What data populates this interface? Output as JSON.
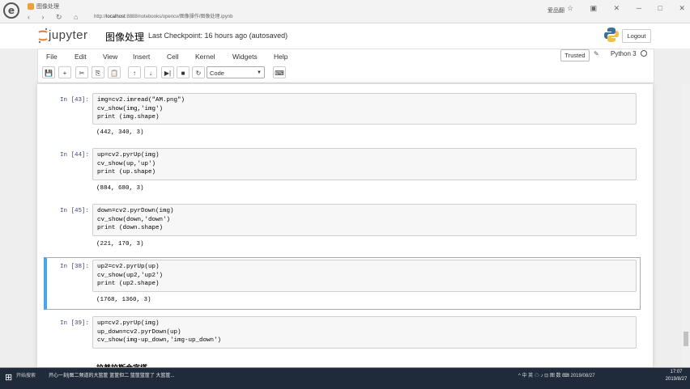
{
  "browser": {
    "logo": "e",
    "tab_title": "图像处理",
    "url_prefix": "http://",
    "url_host": "localhost",
    "url_rest": ":8888/notebooks/opencv/图像操作/图像处理.ipynb",
    "window_title": "爱品翻",
    "nav_icons": "‹ › ↻ ⌂",
    "window_controls": "☆ ▣ ✕ ─ □ ✕"
  },
  "jupyter": {
    "logo_text": "jupyter",
    "notebook_name": "图像处理",
    "checkpoint": "Last Checkpoint: 16 hours ago (autosaved)",
    "logout_label": "Logout",
    "trusted_label": "Trusted",
    "kernel_name": "Python 3"
  },
  "menu": [
    "File",
    "Edit",
    "View",
    "Insert",
    "Cell",
    "Kernel",
    "Widgets",
    "Help"
  ],
  "toolbar": {
    "save": "💾",
    "add": "+",
    "cut": "✂",
    "copy": "⎘",
    "paste": "📋",
    "up": "↑",
    "down": "↓",
    "run": "▶|",
    "stop": "■",
    "restart": "↻",
    "cell_type": "Code",
    "keyboard": "⌨"
  },
  "cells": [
    {
      "prompt": "In [43]:",
      "lines": [
        "img=cv2.imread(\"AM.png\")",
        "cv_show(img,'img')",
        "print (img.shape)"
      ],
      "output": "(442, 340, 3)"
    },
    {
      "prompt": "In [44]:",
      "lines": [
        "up=cv2.pyrUp(img)",
        "cv_show(up,'up')",
        "print (up.shape)"
      ],
      "output": "(884, 680, 3)"
    },
    {
      "prompt": "In [45]:",
      "lines": [
        "down=cv2.pyrDown(img)",
        "cv_show(down,'down')",
        "print (down.shape)"
      ],
      "output": "(221, 170, 3)"
    },
    {
      "prompt": "In [38]:",
      "lines": [
        "up2=cv2.pyrUp(up)",
        "cv_show(up2,'up2')",
        "print (up2.shape)"
      ],
      "output": "(1768, 1360, 3)"
    },
    {
      "prompt": "In [39]:",
      "lines": [
        "up=cv2.pyrUp(img)",
        "up_down=cv2.pyrDown(up)",
        "cv_show(img-up_down,'img-up_down')"
      ],
      "output": ""
    }
  ],
  "partial_heading": "拉普拉斯金字塔",
  "taskbar": {
    "start": "⊞",
    "search": "开始搜索",
    "app_text": "开心一刻|图二频道的大篮筐  篮筐但二 篮筐篮筐了  大篮筐...",
    "tray": "^ 中 英 ☁ ♪ ⊡ 图 数 ⌨ 2019/08/27",
    "time": "17:07",
    "date": "2019/8/27"
  }
}
